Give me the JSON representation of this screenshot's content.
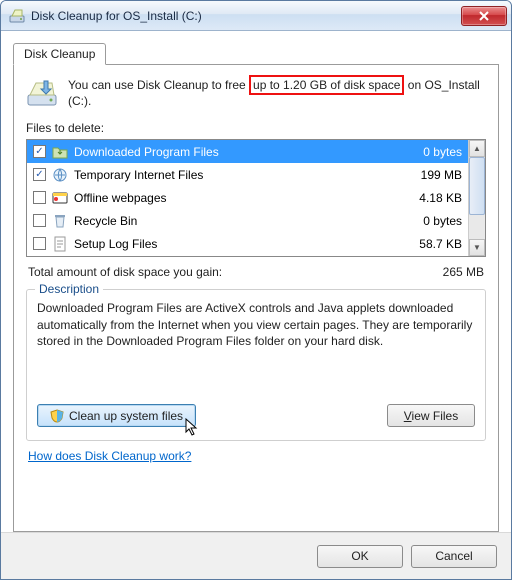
{
  "window": {
    "title": "Disk Cleanup for OS_Install (C:)"
  },
  "tab": {
    "label": "Disk Cleanup"
  },
  "intro": {
    "pre": "You can use Disk Cleanup to free",
    "highlight": "up to 1.20 GB of disk space",
    "post": "on OS_Install (C:)."
  },
  "files_label": "Files to delete:",
  "items": [
    {
      "checked": true,
      "icon": "folder-download",
      "name": "Downloaded Program Files",
      "size": "0 bytes",
      "selected": true
    },
    {
      "checked": true,
      "icon": "ie",
      "name": "Temporary Internet Files",
      "size": "199 MB",
      "selected": false
    },
    {
      "checked": false,
      "icon": "offline",
      "name": "Offline webpages",
      "size": "4.18 KB",
      "selected": false
    },
    {
      "checked": false,
      "icon": "recycle",
      "name": "Recycle Bin",
      "size": "0 bytes",
      "selected": false
    },
    {
      "checked": false,
      "icon": "log",
      "name": "Setup Log Files",
      "size": "58.7 KB",
      "selected": false
    }
  ],
  "total": {
    "label": "Total amount of disk space you gain:",
    "value": "265 MB"
  },
  "description": {
    "title": "Description",
    "text": "Downloaded Program Files are ActiveX controls and Java applets downloaded automatically from the Internet when you view certain pages. They are temporarily stored in the Downloaded Program Files folder on your hard disk."
  },
  "buttons": {
    "clean_system": "Clean up system files",
    "view_files_pre": "iew Files",
    "ok": "OK",
    "cancel": "Cancel"
  },
  "help_link": "How does Disk Cleanup work?"
}
